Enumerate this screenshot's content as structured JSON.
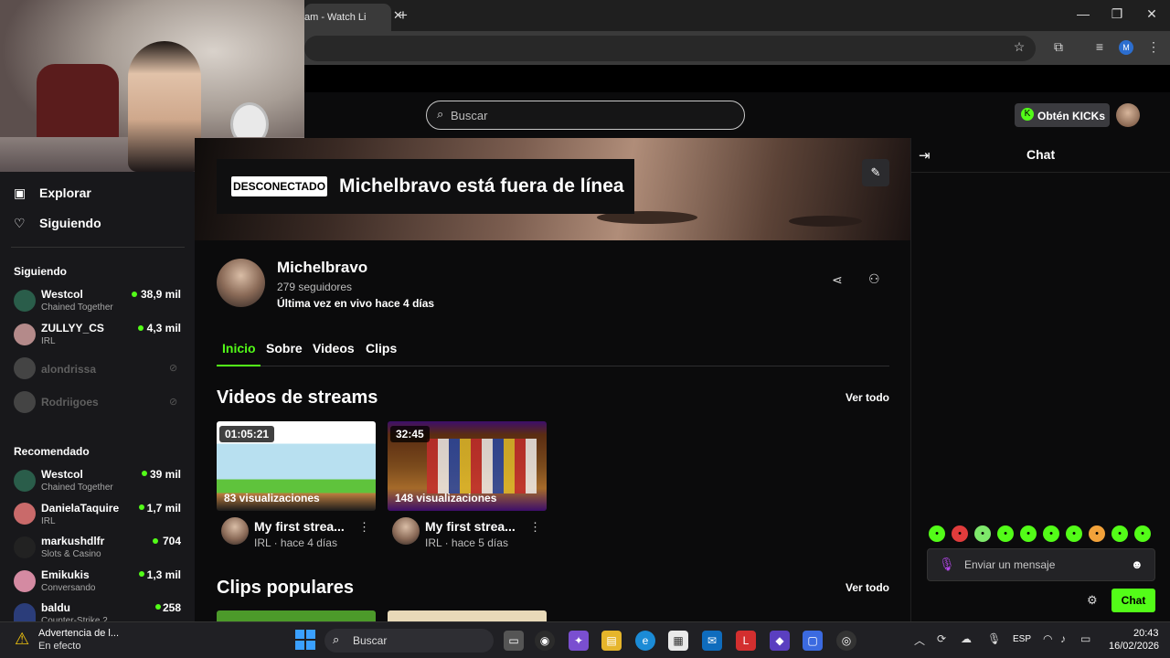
{
  "browser": {
    "tab_title": "am - Watch Li",
    "tab_close": "✕",
    "new_tab": "+",
    "window": {
      "minimize": "—",
      "maximize": "❐",
      "close": "✕"
    },
    "profile_initial": "M"
  },
  "header": {
    "search_placeholder": "Buscar",
    "kicks_button": "Obtén KICKs"
  },
  "sidebar": {
    "nav": [
      {
        "label": "Explorar",
        "icon": "explore-icon"
      },
      {
        "label": "Siguiendo",
        "icon": "heart-icon"
      }
    ],
    "following_heading": "Siguiendo",
    "following": [
      {
        "name": "Westcol",
        "category": "Chained Together",
        "viewers": "38,9 mil",
        "live": true
      },
      {
        "name": "ZULLYY_CS",
        "category": "IRL",
        "viewers": "4,3 mil",
        "live": true
      },
      {
        "name": "alondrissa",
        "live": false
      },
      {
        "name": "Rodriigoes",
        "live": false
      }
    ],
    "recommended_heading": "Recomendado",
    "recommended": [
      {
        "name": "Westcol",
        "category": "Chained Together",
        "viewers": "39 mil"
      },
      {
        "name": "DanielaTaquire",
        "category": "IRL",
        "viewers": "1,7 mil"
      },
      {
        "name": "markushdlfr",
        "category": "Slots & Casino",
        "viewers": "704"
      },
      {
        "name": "Emikukis",
        "category": "Conversando",
        "viewers": "1,3 mil"
      },
      {
        "name": "baldu",
        "category": "Counter-Strike 2",
        "viewers": "258"
      }
    ]
  },
  "banner": {
    "offline_badge": "DESCONECTADO",
    "offline_title": "Michelbravo está fuera de línea"
  },
  "channel": {
    "name": "Michelbravo",
    "followers": "279 seguidores",
    "last_live": "Última vez en vivo hace 4 días",
    "tabs": [
      "Inicio",
      "Sobre",
      "Videos",
      "Clips"
    ],
    "active_tab": "Inicio"
  },
  "videos_section": {
    "title": "Videos de streams",
    "see_all": "Ver todo",
    "items": [
      {
        "duration": "01:05:21",
        "views": "83 visualizaciones",
        "title": "My first strea...",
        "meta": "IRL · hace 4 días"
      },
      {
        "duration": "32:45",
        "views": "148 visualizaciones",
        "title": "My first strea...",
        "meta": "IRL · hace 5 días"
      }
    ]
  },
  "clips_section": {
    "title": "Clips populares",
    "see_all": "Ver todo"
  },
  "chat": {
    "title": "Chat",
    "input_placeholder": "Enviar un mensaje",
    "send_label": "Chat",
    "emote_colors": [
      "#53fc18",
      "#e03c3c",
      "#7ee86b",
      "#53fc18",
      "#53fc18",
      "#53fc18",
      "#53fc18",
      "#f2a23a",
      "#53fc18",
      "#53fc18"
    ]
  },
  "taskbar": {
    "notice_title": "Advertencia de l...",
    "notice_sub": "En efecto",
    "search_label": "Buscar",
    "language": "ESP",
    "time": "20:43",
    "date": "16/02/2026"
  },
  "colors": {
    "accent": "#53fc18",
    "background": "#0b0b0c",
    "sidebar": "#18181b"
  }
}
